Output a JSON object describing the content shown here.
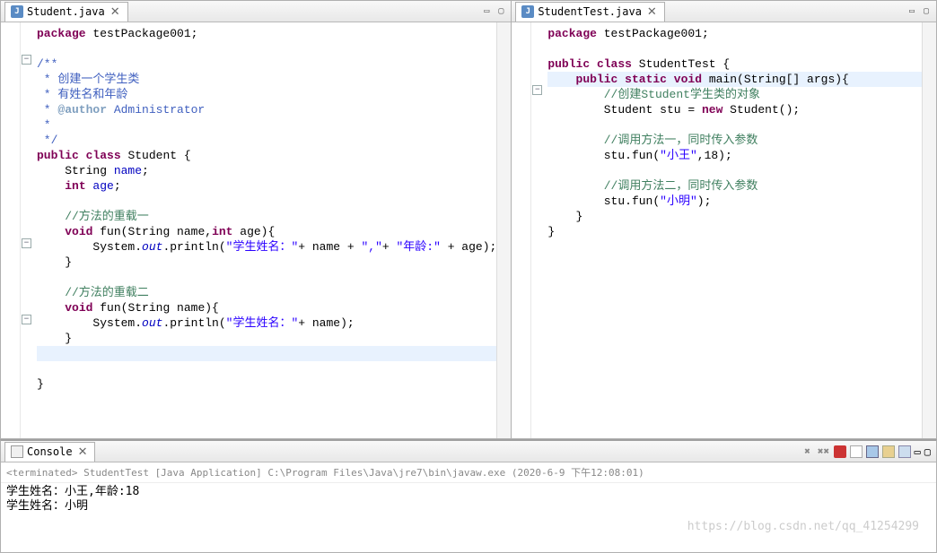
{
  "editor_left": {
    "tab_label": "Student.java",
    "code": {
      "l1_pkg": "package",
      "l1_pkg_name": " testPackage001;",
      "doc1": "/**",
      "doc2": " * 创建一个学生类",
      "doc3": " * 有姓名和年龄",
      "doc4": " * ",
      "doc4_tag": "@author",
      "doc4_rest": " Administrator",
      "doc5": " *",
      "doc6": " */",
      "cls_pub": "public",
      "cls_cls": "class",
      "cls_name": " Student {",
      "f1_t": "    String ",
      "f1_n": "name",
      "f1_e": ";",
      "f2_t": "    ",
      "f2_kw": "int",
      "f2_n": " age",
      "f2_e": ";",
      "c1": "    //方法的重载一",
      "m1a": "    ",
      "m1_kw": "void",
      "m1b": " fun(String name,",
      "m1_kw2": "int",
      "m1c": " age){",
      "p1a": "        System.",
      "p1_out": "out",
      "p1b": ".println(",
      "p1_s1": "\"学生姓名：\"",
      "p1c": "+ name + ",
      "p1_s2": "\",\"",
      "p1d": "+ ",
      "p1_s3": "\"年龄:\"",
      "p1e": " + age);",
      "m1end": "    }",
      "c2": "    //方法的重载二",
      "m2a": "    ",
      "m2_kw": "void",
      "m2b": " fun(String name){",
      "p2a": "        System.",
      "p2_out": "out",
      "p2b": ".println(",
      "p2_s1": "\"学生姓名：\"",
      "p2c": "+ name);",
      "m2end": "    }",
      "clsend": "}"
    }
  },
  "editor_right": {
    "tab_label": "StudentTest.java",
    "code": {
      "l1_pkg": "package",
      "l1_pkg_name": " testPackage001;",
      "cls_pub": "public",
      "cls_cls": "class",
      "cls_name": " StudentTest {",
      "m_a": "    ",
      "m_pub": "public",
      "m_sp1": " ",
      "m_stat": "static",
      "m_sp2": " ",
      "m_void": "void",
      "m_b": " main(String[] args){",
      "c1a": "        //创建",
      "c1b": "Student",
      "c1c": "学生类的对象",
      "n_a": "        Student stu = ",
      "n_kw": "new",
      "n_b": " Student();",
      "c2": "        //调用方法一，同时传入参数",
      "f1a": "        stu.fun(",
      "f1s": "\"小王\"",
      "f1b": ",18);",
      "c3": "        //调用方法二，同时传入参数",
      "f2a": "        stu.fun(",
      "f2s": "\"小明\"",
      "f2b": ");",
      "mend": "    }",
      "clsend": "}"
    }
  },
  "console": {
    "tab_label": "Console",
    "header": "<terminated> StudentTest [Java Application] C:\\Program Files\\Java\\jre7\\bin\\javaw.exe (2020-6-9 下午12:08:01)",
    "out1": "学生姓名：小王,年龄:18",
    "out2": "学生姓名：小明"
  },
  "watermark": "https://blog.csdn.net/qq_41254299"
}
